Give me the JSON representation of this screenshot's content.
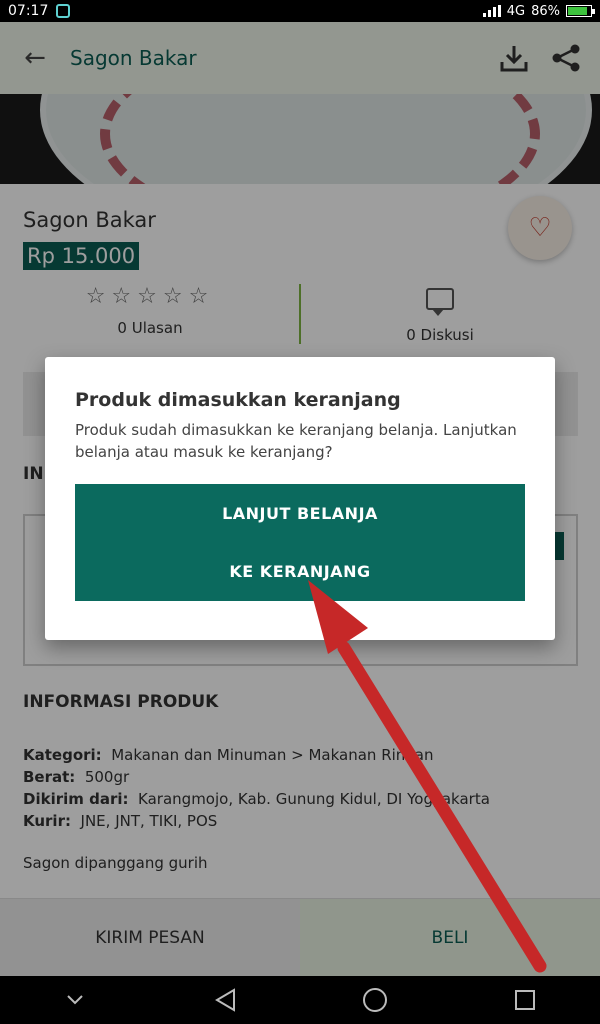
{
  "status": {
    "time": "07:17",
    "network": "4G",
    "battery": "86%",
    "battery_level": 0.86
  },
  "app_bar": {
    "title": "Sagon Bakar",
    "back_icon": "arrow-left-icon",
    "download_icon": "download-icon",
    "share_icon": "share-icon"
  },
  "product": {
    "name": "Sagon Bakar",
    "price": "Rp 15.000",
    "rating_stars": "☆☆☆☆☆",
    "reviews": "0 Ulasan",
    "discussions": "0 Diskusi",
    "section_partial": "INI",
    "info_title": "INFORMASI PRODUK",
    "details": [
      {
        "label": "Kategori:",
        "value": "Makanan dan Minuman > Makanan Ringan"
      },
      {
        "label": "Berat:",
        "value": "500gr"
      },
      {
        "label": "Dikirim dari:",
        "value": "Karangmojo, Kab. Gunung Kidul, DI Yogyakarta"
      },
      {
        "label": "Kurir:",
        "value": "JNE, JNT, TIKI, POS"
      }
    ],
    "description": "Sagon dipanggang gurih"
  },
  "bottom_bar": {
    "message_label": "KIRIM PESAN",
    "buy_label": "BELI"
  },
  "dialog": {
    "title": "Produk dimasukkan keranjang",
    "message": "Produk sudah dimasukkan ke keranjang belanja. Lanjutkan belanja atau masuk ke keranjang?",
    "continue_label": "LANJUT BELANJA",
    "cart_label": "KE KERANJANG"
  },
  "colors": {
    "primary": "#0b6a5e",
    "appbar": "#eef4e8",
    "accent_line": "#7cb342",
    "annotation_arrow": "#c62828"
  }
}
